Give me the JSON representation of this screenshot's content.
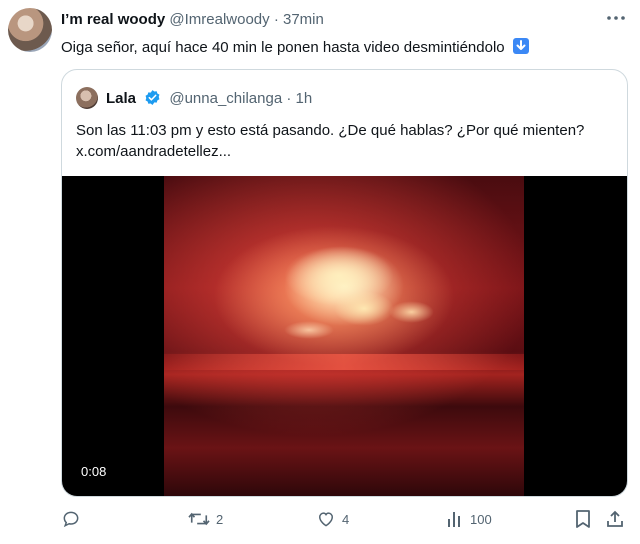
{
  "tweet": {
    "display_name": "I’m real woody",
    "handle": "@Imrealwoody",
    "separator": "·",
    "time": "37min",
    "text": "Oiga señor, aquí hace 40 min le ponen hasta video desmintiéndolo",
    "emoji_icon": "down-arrow-emoji-icon"
  },
  "quote": {
    "display_name": "Lala",
    "handle": "@unna_chilanga",
    "separator": "·",
    "time": "1h",
    "text_line1": "Son las 11:03 pm y esto está pasando. ¿De qué hablas? ¿Por qué mienten?",
    "text_line2": "x.com/aandradetellez...",
    "video_duration": "0:08",
    "verified_color": "#1d9bf0"
  },
  "actions": {
    "reply_icon": "reply-icon",
    "retweet_icon": "retweet-icon",
    "retweet_count": "2",
    "like_icon": "heart-icon",
    "like_count": "4",
    "views_icon": "views-icon",
    "views_count": "100",
    "bookmark_icon": "bookmark-icon",
    "share_icon": "share-icon"
  },
  "colors": {
    "text_primary": "#0f1419",
    "text_secondary": "#536471",
    "border": "#cfd9de",
    "accent": "#1d9bf0"
  }
}
